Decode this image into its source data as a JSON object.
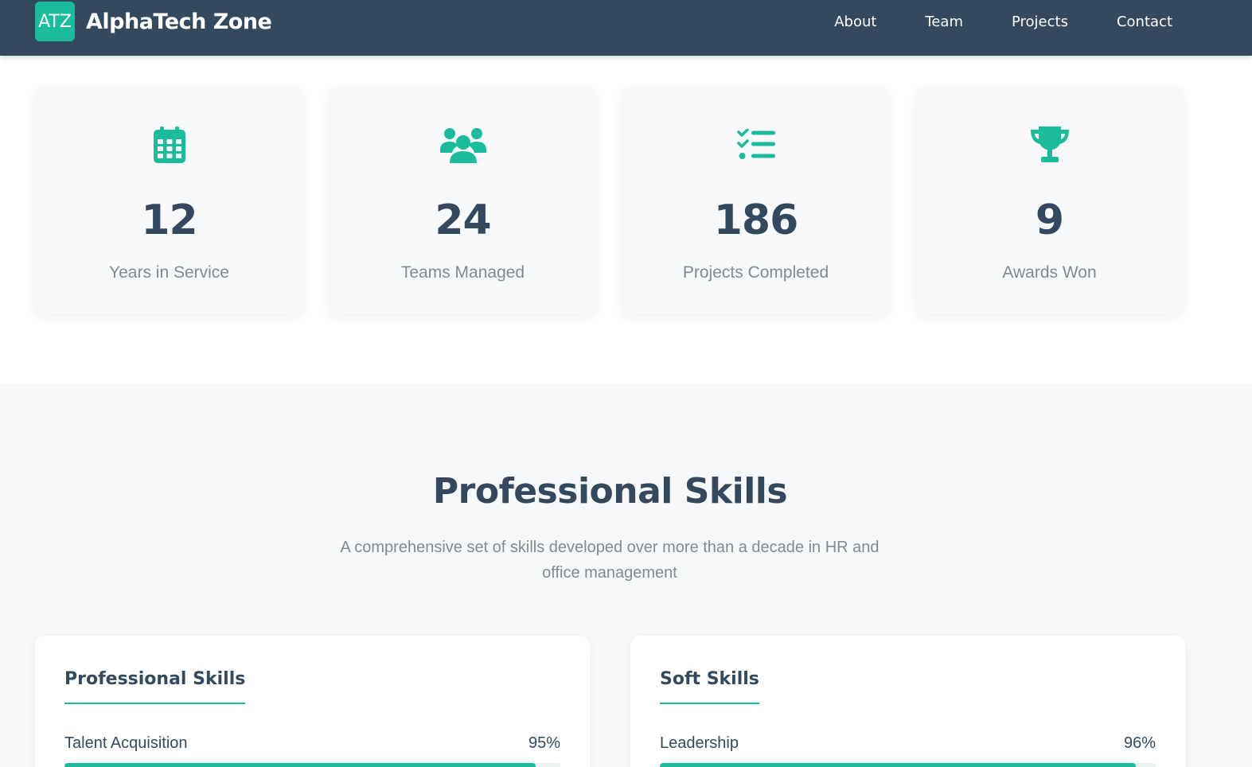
{
  "brand": {
    "badge": "ATZ",
    "name": "AlphaTech Zone",
    "accent_color": "#1abc9c",
    "header_color": "#34495e"
  },
  "nav": {
    "items": [
      {
        "label": "About"
      },
      {
        "label": "Team"
      },
      {
        "label": "Projects"
      },
      {
        "label": "Contact"
      }
    ]
  },
  "stats": [
    {
      "icon": "calendar-icon",
      "number": "12",
      "label": "Years in Service"
    },
    {
      "icon": "users-icon",
      "number": "24",
      "label": "Teams Managed"
    },
    {
      "icon": "checklist-icon",
      "number": "186",
      "label": "Projects Completed"
    },
    {
      "icon": "trophy-icon",
      "number": "9",
      "label": "Awards Won"
    }
  ],
  "skills_section": {
    "title": "Professional Skills",
    "subtitle": "A comprehensive set of skills developed over more than a decade in HR and office management",
    "cards": [
      {
        "title": "Professional Skills",
        "skills": [
          {
            "name": "Talent Acquisition",
            "percent": "95%",
            "value": 95
          }
        ]
      },
      {
        "title": "Soft Skills",
        "skills": [
          {
            "name": "Leadership",
            "percent": "96%",
            "value": 96
          }
        ]
      }
    ]
  }
}
